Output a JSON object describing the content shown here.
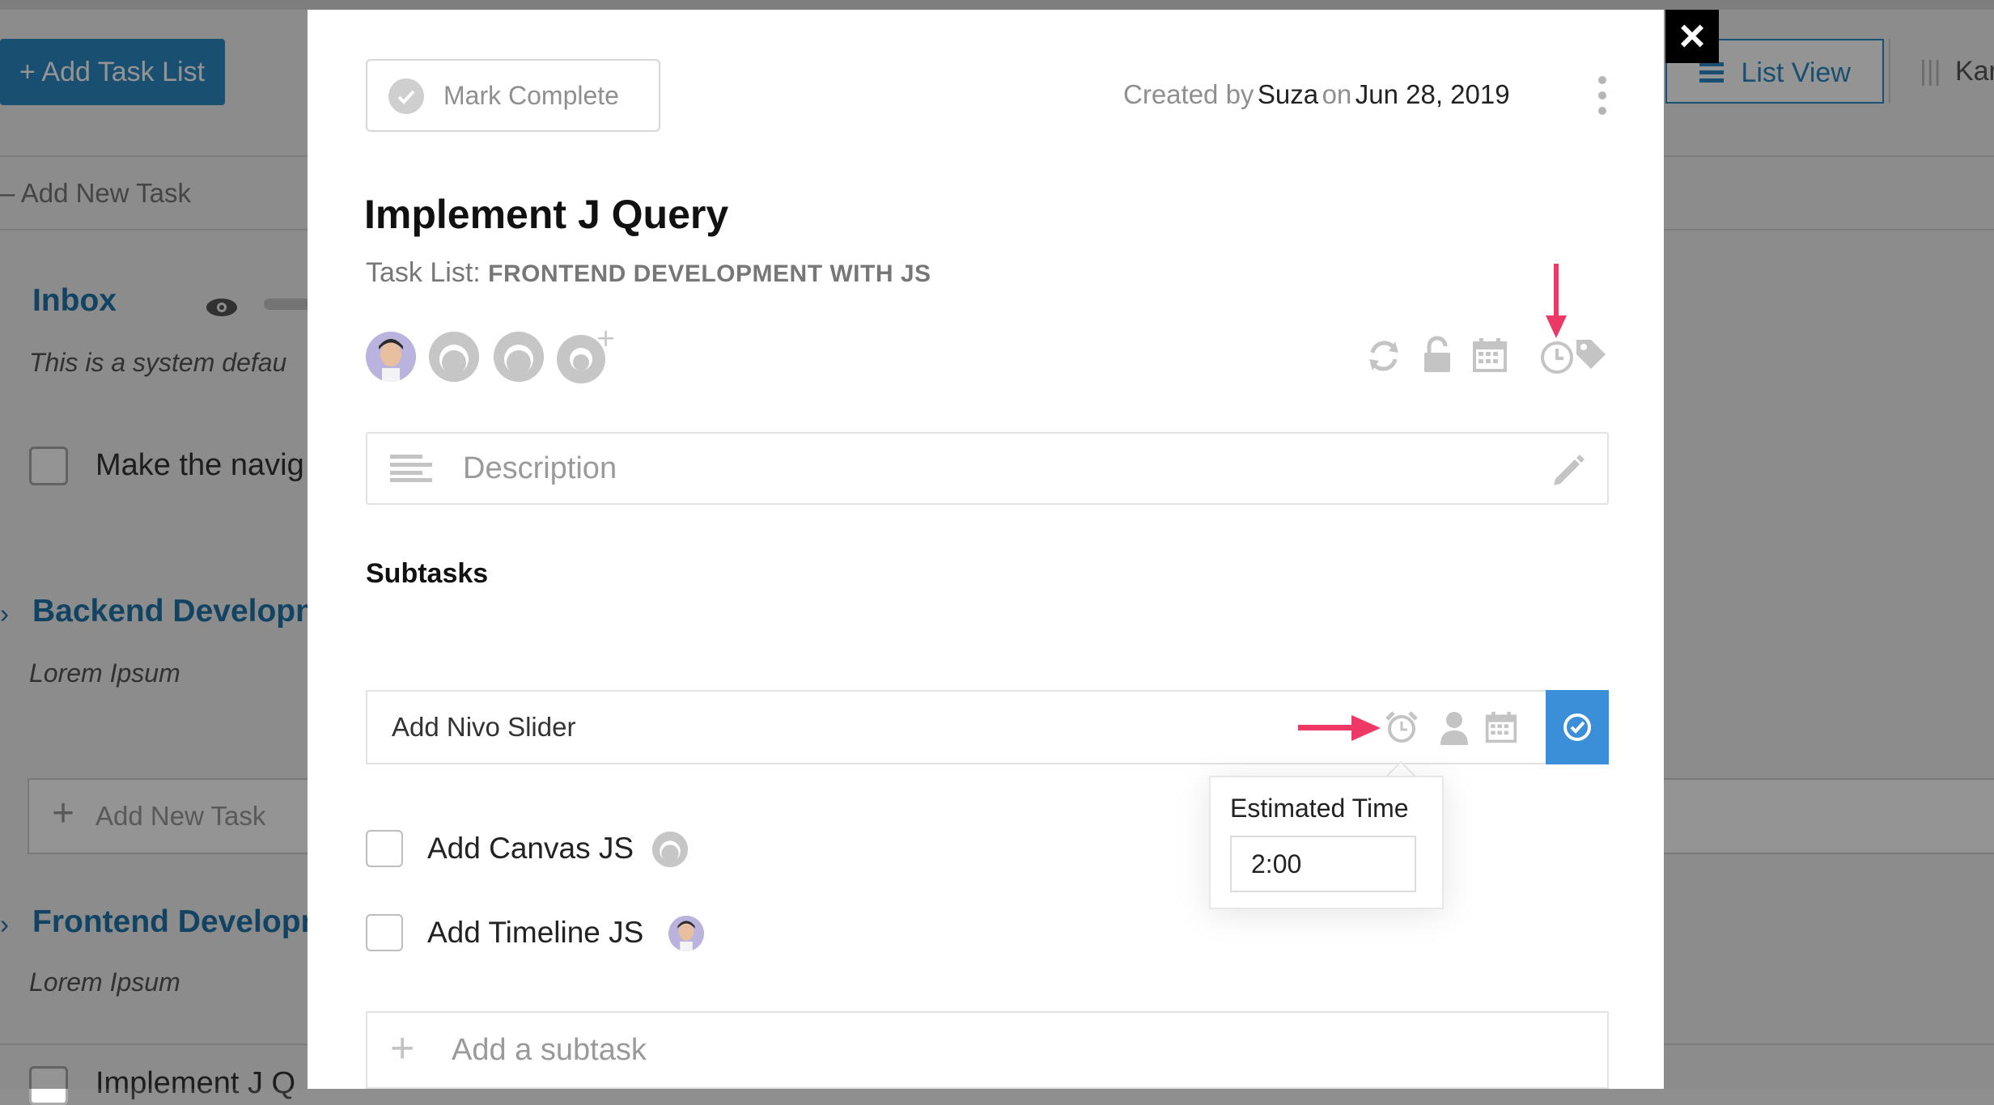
{
  "background": {
    "add_task_list_label": "+ Add Task List",
    "add_new_task_top": "–  Add New Task",
    "list_view_label": "List View",
    "kanban_label": "Kar",
    "sections": [
      {
        "title": "Inbox",
        "description": "This is a system defau",
        "task": "Make the navig"
      },
      {
        "title": "Backend Developn",
        "description": "Lorem Ipsum"
      },
      {
        "title": "Frontend Developn",
        "description": "Lorem Ipsum",
        "task": "Implement J Q"
      }
    ],
    "add_new_task_box": "Add New Task"
  },
  "modal": {
    "mark_complete_label": "Mark Complete",
    "created_by_prefix": "Created by",
    "created_by_user": "Suza",
    "created_on_word": "on",
    "created_date": "Jun 28, 2019",
    "task_title": "Implement J Query",
    "task_list_prefix": "Task List:",
    "task_list_name": "FRONTEND DEVELOPMENT WITH JS",
    "description_placeholder": "Description",
    "subtasks_heading": "Subtasks",
    "subtask_input_value": "Add Nivo Slider",
    "estimated_time": {
      "label": "Estimated Time",
      "value": "2:00"
    },
    "subtasks": [
      {
        "label": "Add Canvas JS",
        "assignee": "blank-avatar"
      },
      {
        "label": "Add Timeline JS",
        "assignee": "photo-avatar"
      }
    ],
    "add_subtask_placeholder": "Add a subtask"
  },
  "colors": {
    "accent": "#2c88c1",
    "submit": "#3b8fd9",
    "annotation_arrow": "#ee3865",
    "icon_grey": "#c4c4c4"
  },
  "icons": [
    "close-icon",
    "check-circle-icon",
    "kebab-menu-icon",
    "repeat-icon",
    "unlock-icon",
    "calendar-icon",
    "clock-icon",
    "tag-icon",
    "add-user-icon",
    "text-lines-icon",
    "pencil-icon",
    "alarm-clock-icon",
    "user-icon",
    "check-icon",
    "plus-icon",
    "eye-icon"
  ]
}
